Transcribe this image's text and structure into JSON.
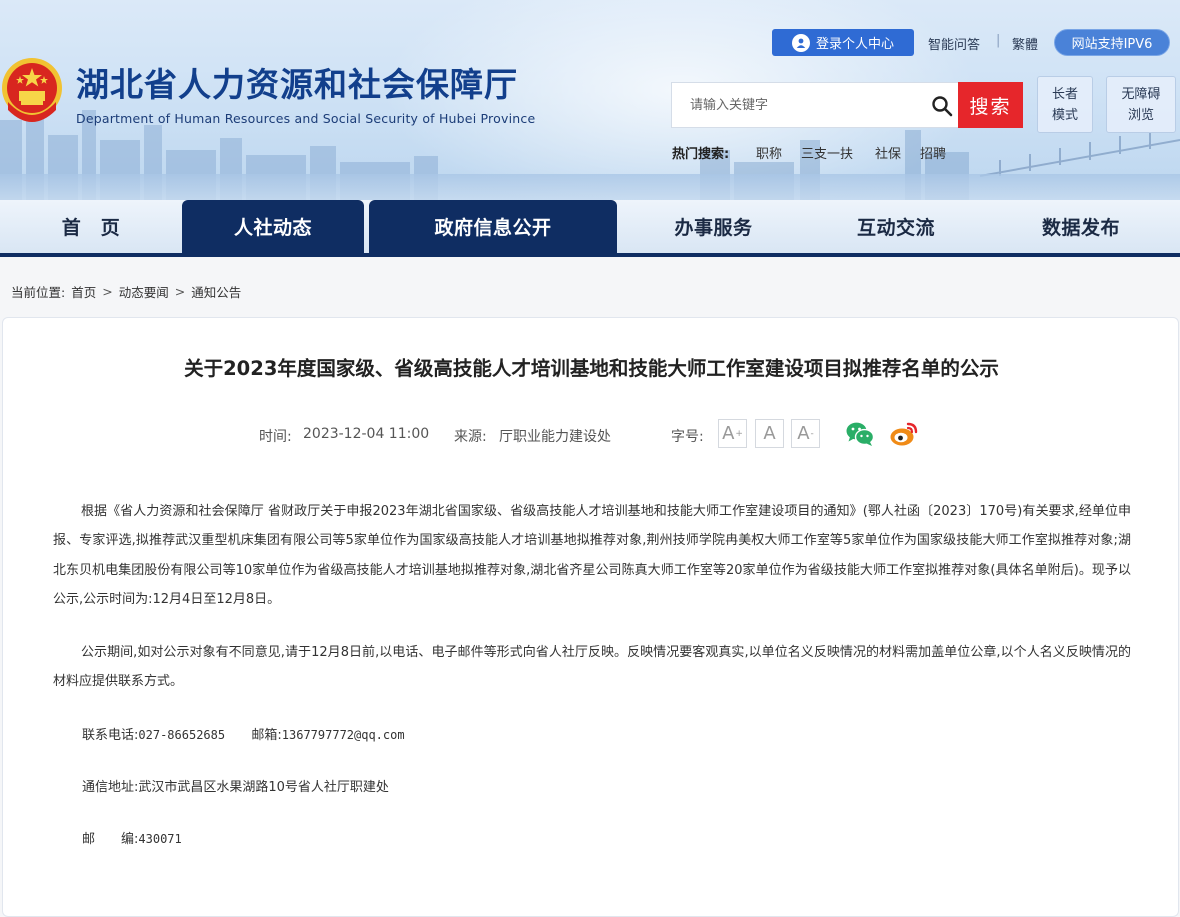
{
  "header": {
    "site_title": "湖北省人力资源和社会保障厅",
    "site_subtitle": "Department of Human Resources and Social Security of Hubei Province",
    "login_label": "登录个人中心",
    "links": [
      "智能问答",
      "繁體"
    ],
    "separator": "|",
    "ipv6_label": "网站支持IPV6",
    "search_placeholder": "请输入关键字",
    "search_button": "搜索",
    "elder_mode": [
      "长者",
      "模式"
    ],
    "accessible_mode": [
      "无障碍",
      "浏览"
    ],
    "hot_label": "热门搜索:",
    "hot_terms": [
      "职称",
      "三支一扶",
      "社保",
      "招聘"
    ]
  },
  "nav": {
    "items": [
      "首　页",
      "人社动态",
      "政府信息公开",
      "办事服务",
      "互动交流",
      "数据发布"
    ],
    "active": [
      "人社动态",
      "政府信息公开"
    ]
  },
  "breadcrumb": {
    "label": "当前位置:",
    "items": [
      "首页",
      "动态要闻",
      "通知公告"
    ],
    "separator": ">"
  },
  "article": {
    "title": "关于2023年度国家级、省级高技能人才培训基地和技能大师工作室建设项目拟推荐名单的公示",
    "time_label": "时间:",
    "time_value": "2023-12-04 11:00",
    "source_label": "来源:",
    "source_value": "厅职业能力建设处",
    "font_size_label": "字号:",
    "font_buttons": [
      "A",
      "A",
      "A"
    ],
    "font_button_suffix": [
      "+",
      "",
      "-"
    ],
    "share_icons": [
      "wechat-icon",
      "weibo-icon"
    ],
    "paragraph_1": "根据《省人力资源和社会保障厅 省财政厅关于申报2023年湖北省国家级、省级高技能人才培训基地和技能大师工作室建设项目的通知》(鄂人社函〔2023〕170号)有关要求,经单位申报、专家评选,拟推荐武汉重型机床集团有限公司等5家单位作为国家级高技能人才培训基地拟推荐对象,荆州技师学院冉美权大师工作室等5家单位作为国家级技能大师工作室拟推荐对象;湖北东贝机电集团股份有限公司等10家单位作为省级高技能人才培训基地拟推荐对象,湖北省齐星公司陈真大师工作室等20家单位作为省级技能大师工作室拟推荐对象(具体名单附后)。现予以公示,公示时间为:12月4日至12月8日。",
    "paragraph_2": "公示期间,如对公示对象有不同意见,请于12月8日前,以电话、电子邮件等形式向省人社厅反映。反映情况要客观真实,以单位名义反映情况的材料需加盖单位公章,以个人名义反映情况的材料应提供联系方式。",
    "phone_label": "联系电话:",
    "phone_value": "027-86652685",
    "email_label": "邮箱:",
    "email_value": "1367797772@qq.com",
    "address_label": "通信地址:",
    "address_value": "武汉市武昌区水果湖路10号省人社厅职建处",
    "postcode_label": "邮　　编:",
    "postcode_value": "430071"
  },
  "colors": {
    "title_blue": "#123f8c",
    "nav_active": "#0f2d62",
    "search_red": "#e6262b",
    "login_blue": "#2f6bd4",
    "wechat_green": "#2aae67",
    "weibo_orange": "#f08b17"
  }
}
